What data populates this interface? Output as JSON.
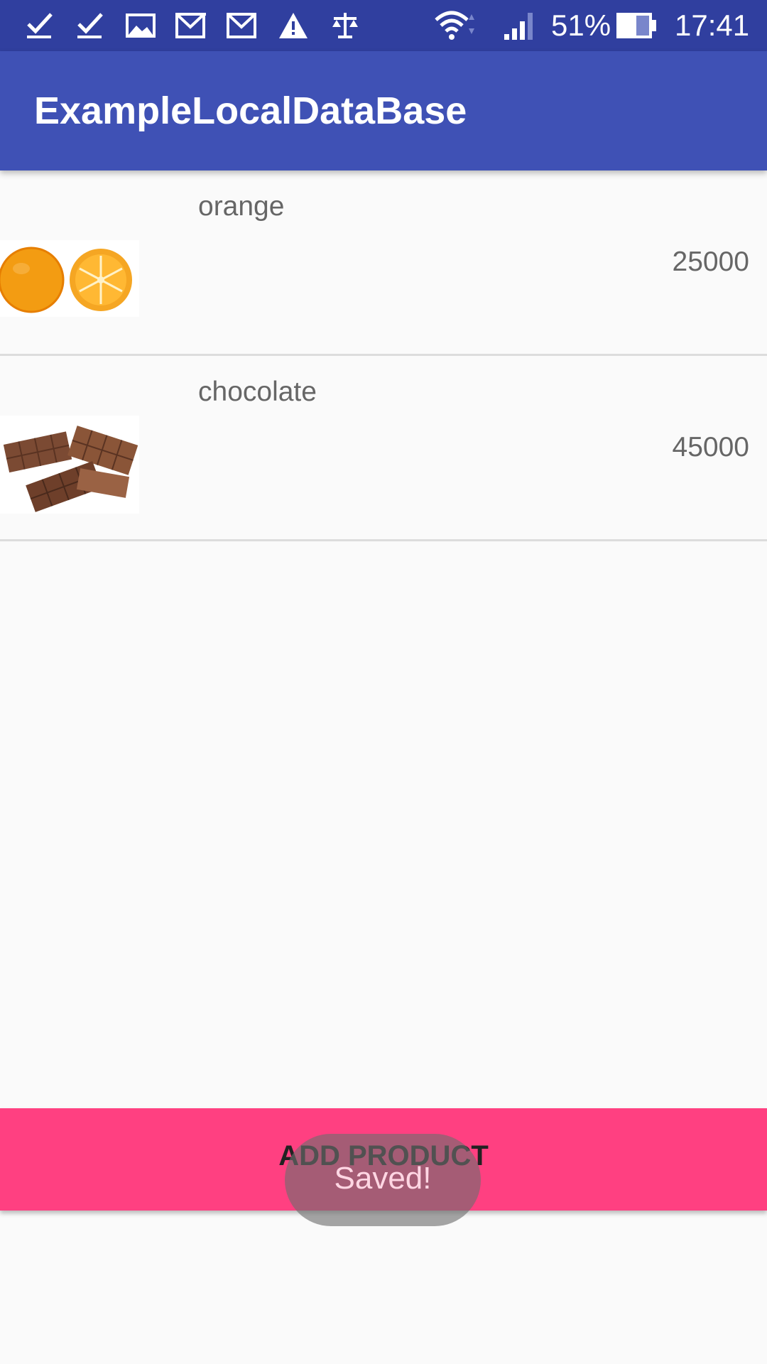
{
  "status_bar": {
    "battery_percent": "51%",
    "time": "17:41",
    "icons": [
      "check-icon",
      "check-icon",
      "image-icon",
      "gmail-icon",
      "gmail-icon",
      "warning-icon",
      "scale-icon",
      "wifi-icon",
      "signal-icon",
      "battery-icon"
    ]
  },
  "app_bar": {
    "title": "ExampleLocalDataBase"
  },
  "products": [
    {
      "name": "orange",
      "price": "25000",
      "image": "orange-image"
    },
    {
      "name": "chocolate",
      "price": "45000",
      "image": "chocolate-image"
    }
  ],
  "add_button": {
    "label": "ADD PRODUCT"
  },
  "toast": {
    "message": "Saved!"
  },
  "colors": {
    "status_bar": "#303f9f",
    "app_bar": "#3f51b5",
    "accent": "#ff4081",
    "background": "#fafafa"
  }
}
